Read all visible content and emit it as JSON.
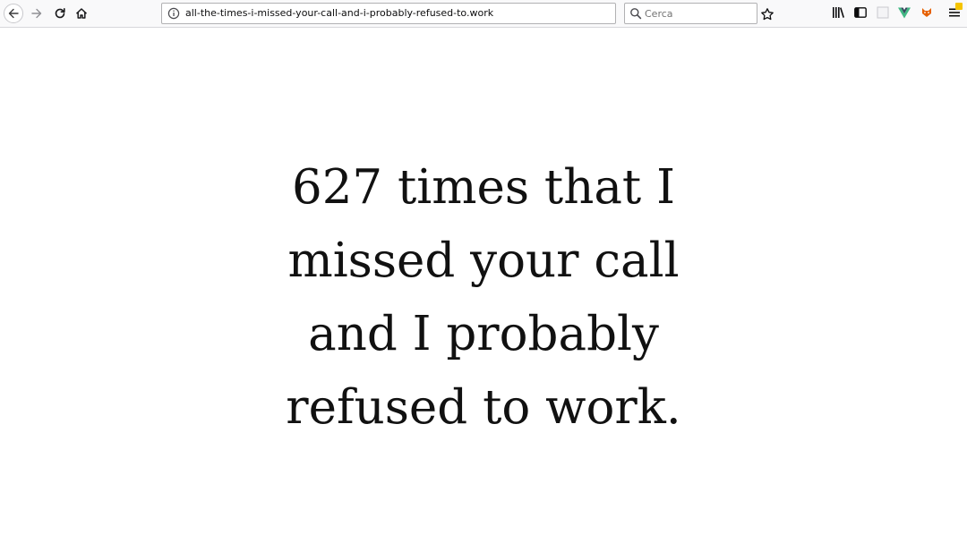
{
  "browser": {
    "url": "all-the-times-i-missed-your-call-and-i-probably-refused-to.work",
    "search_placeholder": "Cerca",
    "page_actions_label": "•••",
    "accent_badge_color": "#f5c400"
  },
  "icons": {
    "back": "back-arrow-icon",
    "forward": "forward-arrow-icon",
    "reload": "reload-icon",
    "home": "home-icon",
    "info": "info-icon",
    "pocket": "pocket-icon",
    "bookmark": "star-icon",
    "search": "search-icon",
    "library": "library-icon",
    "sidebar": "sidebar-icon",
    "menu": "hamburger-menu-icon"
  },
  "page": {
    "lines": [
      "627 times that I",
      "missed your call",
      "and I probably",
      "refused to work."
    ]
  }
}
